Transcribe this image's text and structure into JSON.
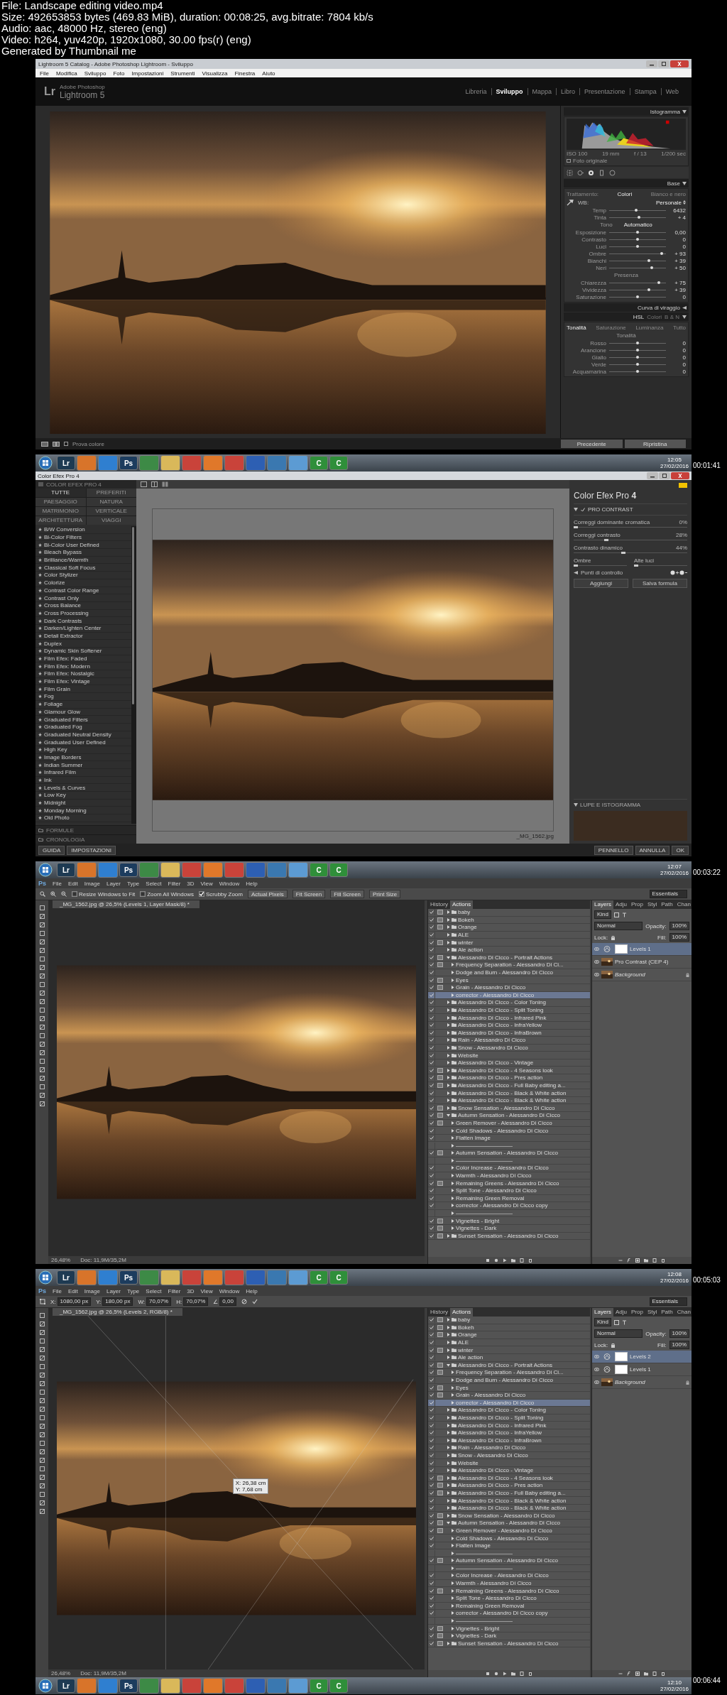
{
  "file_info": [
    "File: Landscape editing video.mp4",
    "Size: 492653853 bytes (469.83 MiB), duration: 00:08:25, avg.bitrate: 7804 kb/s",
    "Audio: aac, 48000 Hz, stereo (eng)",
    "Video: h264, yuv420p, 1920x1080, 30.00 fps(r) (eng)",
    "Generated by Thumbnail me"
  ],
  "frames": [
    {
      "kind": "lightroom",
      "window_title": "Lightroom 5 Catalog - Adobe Photoshop Lightroom - Sviluppo",
      "menu": [
        "File",
        "Modifica",
        "Sviluppo",
        "Foto",
        "Impostazioni",
        "Strumenti",
        "Visualizza",
        "Finestra",
        "Aiuto"
      ],
      "logo": {
        "badge": "Lr",
        "subtitle": "Adobe Photoshop",
        "name": "Lightroom 5"
      },
      "modules": [
        {
          "label": "Libreria",
          "selected": false
        },
        {
          "label": "Sviluppo",
          "selected": true
        },
        {
          "label": "Mappa",
          "selected": false
        },
        {
          "label": "Libro",
          "selected": false
        },
        {
          "label": "Presentazione",
          "selected": false
        },
        {
          "label": "Stampa",
          "selected": false
        },
        {
          "label": "Web",
          "selected": false
        }
      ],
      "histogram": {
        "title": "Istogramma",
        "readouts": [
          "ISO 100",
          "19 mm",
          "f / 13",
          "1/200 sec"
        ],
        "original_label": "Foto originale"
      },
      "base": {
        "title": "Base",
        "treatment_label": "Trattamento:",
        "treatments": [
          {
            "label": "Colori",
            "selected": true
          },
          {
            "label": "Bianco e nero",
            "selected": false
          }
        ],
        "wb_label": "WB:",
        "wb_value": "Personale",
        "groups": [
          {
            "sliders": [
              {
                "label": "Temp",
                "value": "6432",
                "level": 0.47
              },
              {
                "label": "Tinta",
                "value": "+ 4",
                "level": 0.53
              }
            ]
          },
          {
            "heading": "Tono",
            "action": "Automatico",
            "sliders": [
              {
                "label": "Esposizione",
                "value": "0,00",
                "level": 0.5
              },
              {
                "label": "Contrasto",
                "value": "0",
                "level": 0.5
              }
            ]
          },
          {
            "sliders": [
              {
                "label": "Luci",
                "value": "0",
                "level": 0.5
              },
              {
                "label": "Ombre",
                "value": "+ 93",
                "level": 0.93
              },
              {
                "label": "Bianchi",
                "value": "+ 39",
                "level": 0.7
              },
              {
                "label": "Neri",
                "value": "+ 50",
                "level": 0.75
              }
            ]
          },
          {
            "heading": "Presenza",
            "sliders": [
              {
                "label": "Chiarezza",
                "value": "+ 75",
                "level": 0.88
              },
              {
                "label": "Vividezza",
                "value": "+ 39",
                "level": 0.7
              },
              {
                "label": "Saturazione",
                "value": "0",
                "level": 0.5
              }
            ]
          }
        ]
      },
      "tone_curve_title": "Curva di viraggio",
      "hsl": {
        "modes": [
          {
            "label": "HSL",
            "selected": true
          },
          {
            "label": "Colori",
            "selected": false
          },
          {
            "label": "B & N",
            "selected": false
          }
        ],
        "tabs": [
          {
            "label": "Tonalità",
            "selected": true
          },
          {
            "label": "Saturazione",
            "selected": false
          },
          {
            "label": "Luminanza",
            "selected": false
          },
          {
            "label": "Tutto",
            "selected": false
          }
        ],
        "heading": "Tonalità",
        "sliders": [
          {
            "label": "Rosso",
            "value": "0",
            "level": 0.5
          },
          {
            "label": "Arancione",
            "value": "0",
            "level": 0.5
          },
          {
            "label": "Giallo",
            "value": "0",
            "level": 0.5
          },
          {
            "label": "Verde",
            "value": "0",
            "level": 0.5
          },
          {
            "label": "Acquamarina",
            "value": "0",
            "level": 0.5
          }
        ]
      },
      "toolbar_label": "Prova colore",
      "buttons": [
        "Precedente",
        "Ripristina"
      ]
    },
    {
      "kind": "color_efex",
      "timestamp": "00:01:41",
      "taskbar": {
        "apps": [
          {
            "label": "Lr",
            "color": "#1e3a52"
          },
          {
            "color": "#d8742a"
          },
          {
            "color": "#2f7fd0"
          },
          {
            "label": "Ps",
            "color": "#1c3c5e"
          },
          {
            "color": "#3d8a46"
          },
          {
            "color": "#d9b85a"
          },
          {
            "color": "#c9433a"
          },
          {
            "color": "#e0782a"
          },
          {
            "color": "#c9433a"
          },
          {
            "color": "#2d5fb3"
          },
          {
            "color": "#3a78b0"
          },
          {
            "color": "#5c9bd3"
          },
          {
            "label": "C",
            "color": "#2f8f3a"
          },
          {
            "label": "C",
            "color": "#2f8f3a"
          }
        ],
        "time": "12:05",
        "date": "27/02/2016"
      },
      "window_title": "Color Efex Pro 4",
      "library": {
        "title": "COLOR EFEX PRO 4",
        "categories": [
          {
            "label": "TUTTE",
            "selected": true
          },
          {
            "label": "PREFERITI",
            "selected": false
          },
          {
            "label": "PAESAGGIO",
            "selected": false
          },
          {
            "label": "NATURA",
            "selected": false
          },
          {
            "label": "MATRIMONIO",
            "selected": false
          },
          {
            "label": "VERTICALE",
            "selected": false
          },
          {
            "label": "ARCHITETTURA",
            "selected": false
          },
          {
            "label": "VIAGGI",
            "selected": false
          }
        ],
        "filters": [
          {
            "name": "B/W Conversion",
            "selected": false
          },
          {
            "name": "Bi-Color Filters",
            "selected": false
          },
          {
            "name": "Bi-Color User Defined",
            "selected": false
          },
          {
            "name": "Bleach Bypass",
            "selected": false
          },
          {
            "name": "Brilliance/Warmth",
            "selected": false
          },
          {
            "name": "Classical Soft Focus",
            "selected": false
          },
          {
            "name": "Color Stylizer",
            "selected": false
          },
          {
            "name": "Colorize",
            "selected": false
          },
          {
            "name": "Contrast Color Range",
            "selected": false
          },
          {
            "name": "Contrast Only",
            "selected": false
          },
          {
            "name": "Cross Balance",
            "selected": false
          },
          {
            "name": "Cross Processing",
            "selected": false
          },
          {
            "name": "Dark Contrasts",
            "selected": false
          },
          {
            "name": "Darken/Lighten Center",
            "selected": false
          },
          {
            "name": "Detail Extractor",
            "selected": false
          },
          {
            "name": "Duplex",
            "selected": false
          },
          {
            "name": "Dynamic Skin Softener",
            "selected": false
          },
          {
            "name": "Film Efex: Faded",
            "selected": false
          },
          {
            "name": "Film Efex: Modern",
            "selected": false
          },
          {
            "name": "Film Efex: Nostalgic",
            "selected": false
          },
          {
            "name": "Film Efex: Vintage",
            "selected": false
          },
          {
            "name": "Film Grain",
            "selected": false
          },
          {
            "name": "Fog",
            "selected": false
          },
          {
            "name": "Foliage",
            "selected": false
          },
          {
            "name": "Glamour Glow",
            "selected": false
          },
          {
            "name": "Graduated Filters",
            "selected": false
          },
          {
            "name": "Graduated Fog",
            "selected": false
          },
          {
            "name": "Graduated Neutral Density",
            "selected": false
          },
          {
            "name": "Graduated User Defined",
            "selected": false
          },
          {
            "name": "High Key",
            "selected": false
          },
          {
            "name": "Image Borders",
            "selected": false
          },
          {
            "name": "Indian Summer",
            "selected": false
          },
          {
            "name": "Infrared Film",
            "selected": false
          },
          {
            "name": "Ink",
            "selected": false
          },
          {
            "name": "Levels & Curves",
            "selected": false
          },
          {
            "name": "Low Key",
            "selected": false
          },
          {
            "name": "Midnight",
            "selected": false
          },
          {
            "name": "Monday Morning",
            "selected": false
          },
          {
            "name": "Old Photo",
            "selected": false
          }
        ],
        "sections": [
          "FORMULE",
          "CRONOLOGIA"
        ]
      },
      "filename": "_MG_1562.jpg",
      "controls": {
        "title": "Color Efex Pro **4**",
        "filter": {
          "name": "PRO CONTRAST",
          "enabled": true
        },
        "sliders": [
          {
            "label": "Correggi dominante cromatica",
            "value": "0%",
            "level": 0
          },
          {
            "label": "Correggi contrasto",
            "value": "28%",
            "level": 0.28
          },
          {
            "label": "Contrasto dinamico",
            "value": "44%",
            "level": 0.44
          }
        ],
        "tone_sliders": [
          {
            "label": "Ombre",
            "level": 0
          },
          {
            "label": "Alte luci",
            "level": 0
          }
        ],
        "control_points_label": "Punti di controllo",
        "buttons": [
          "Aggiungi",
          "Salva formula"
        ],
        "loupe_label": "LUPE E ISTOGRAMMA"
      },
      "footer_left": [
        "GUIDA",
        "IMPOSTAZIONI"
      ],
      "footer_right": [
        "PENNELLO",
        "ANNULLA",
        "OK"
      ]
    },
    {
      "kind": "photoshop",
      "timestamp": "00:03:22",
      "taskbar": {
        "apps": [
          {
            "label": "Lr",
            "color": "#1e3a52"
          },
          {
            "color": "#d8742a"
          },
          {
            "color": "#2f7fd0"
          },
          {
            "label": "Ps",
            "color": "#1c3c5e"
          },
          {
            "color": "#3d8a46"
          },
          {
            "color": "#d9b85a"
          },
          {
            "color": "#c9433a"
          },
          {
            "color": "#e0782a"
          },
          {
            "color": "#c9433a"
          },
          {
            "color": "#2d5fb3"
          },
          {
            "color": "#3a78b0"
          },
          {
            "color": "#5c9bd3"
          },
          {
            "label": "C",
            "color": "#2f8f3a"
          },
          {
            "label": "C",
            "color": "#2f8f3a"
          }
        ],
        "time": "12:07",
        "date": "27/02/2016"
      },
      "logo": "Ps",
      "menu": [
        "File",
        "Edit",
        "Image",
        "Layer",
        "Type",
        "Select",
        "Filter",
        "3D",
        "View",
        "Window",
        "Help"
      ],
      "options": [
        {
          "kind": "checkbox",
          "label": "Resize Windows to Fit",
          "checked": false
        },
        {
          "kind": "checkbox",
          "label": "Zoom All Windows",
          "checked": false
        },
        {
          "kind": "checkbox",
          "label": "Scrubby Zoom",
          "checked": true
        },
        {
          "kind": "button",
          "label": "Actual Pixels"
        },
        {
          "kind": "button",
          "label": "Fit Screen"
        },
        {
          "kind": "button",
          "label": "Fill Screen"
        },
        {
          "kind": "button",
          "label": "Print Size"
        }
      ],
      "workspace": "Essentials",
      "document_tab": "_MG_1562.jpg @ 26,5% (Levels 1, Layer Mask/8) *",
      "status": [
        "26,48%",
        "Doc: 11,9M/35,2M"
      ],
      "actions_panel": {
        "tabs": [
          {
            "label": "History",
            "selected": false
          },
          {
            "label": "Actions",
            "selected": true
          }
        ],
        "items": [
          {
            "kind": "set",
            "name": "baby",
            "checked": true,
            "dialog": true,
            "expanded": false,
            "selected": false
          },
          {
            "kind": "set",
            "name": "Bokeh",
            "checked": true,
            "dialog": true,
            "expanded": false,
            "selected": false
          },
          {
            "kind": "set",
            "name": "Orange",
            "checked": true,
            "dialog": true,
            "expanded": false,
            "selected": false
          },
          {
            "kind": "set",
            "name": "ALE",
            "checked": true,
            "dialog": false,
            "expanded": false,
            "selected": false
          },
          {
            "kind": "set",
            "name": "winter",
            "checked": true,
            "dialog": true,
            "expanded": false,
            "selected": false
          },
          {
            "kind": "set",
            "name": "Ale action",
            "checked": true,
            "dialog": false,
            "expanded": false,
            "selected": false
          },
          {
            "kind": "set",
            "name": "Alessandro Di Cicco - Portrait Actions",
            "checked": true,
            "dialog": true,
            "expanded": true,
            "selected": false,
            "children": [
              {
                "kind": "action",
                "name": "Frequency Separation - Alessandro Di Ci...",
                "checked": true,
                "dialog": true,
                "selected": false
              },
              {
                "kind": "action",
                "name": "Dodge and Burn - Alessandro Di Cicco",
                "checked": true,
                "dialog": false,
                "selected": false
              },
              {
                "kind": "action",
                "name": "Eyes",
                "checked": true,
                "dialog": true,
                "selected": false
              },
              {
                "kind": "action",
                "name": "Grain - Alessandro Di Cicco",
                "checked": true,
                "dialog": true,
                "selected": false
              },
              {
                "kind": "action",
                "name": "corrector - Alessandro Di Cicco",
                "checked": true,
                "dialog": false,
                "selected": true
              }
            ]
          },
          {
            "kind": "set",
            "name": "Alessandro Di Cicco - Color Toning",
            "checked": true,
            "dialog": false,
            "expanded": false,
            "selected": false
          },
          {
            "kind": "set",
            "name": "Alessandro Di Cicco - Split Toning",
            "checked": true,
            "dialog": false,
            "expanded": false,
            "selected": false
          },
          {
            "kind": "set",
            "name": "Alessandro Di Cicco - Infrared Pink",
            "checked": true,
            "dialog": false,
            "expanded": false,
            "selected": false
          },
          {
            "kind": "set",
            "name": "Alessandro Di Cicco - InfraYellow",
            "checked": true,
            "dialog": false,
            "expanded": false,
            "selected": false
          },
          {
            "kind": "set",
            "name": "Alessandro Di Cicco - InfraBrown",
            "checked": true,
            "dialog": false,
            "expanded": false,
            "selected": false
          },
          {
            "kind": "set",
            "name": "Rain - Alessandro Di Cicco",
            "checked": true,
            "dialog": false,
            "expanded": false,
            "selected": false
          },
          {
            "kind": "set",
            "name": "Snow - Alessandro Di Cicco",
            "checked": true,
            "dialog": false,
            "expanded": false,
            "selected": false
          },
          {
            "kind": "set",
            "name": "Website",
            "checked": true,
            "dialog": false,
            "expanded": false,
            "selected": false
          },
          {
            "kind": "set",
            "name": "Alessandro Di Cicco - Vintage",
            "checked": true,
            "dialog": false,
            "expanded": false,
            "selected": false
          },
          {
            "kind": "set",
            "name": "Alessandro Di Cicco - 4 Seasons look",
            "checked": true,
            "dialog": true,
            "expanded": false,
            "selected": false
          },
          {
            "kind": "set",
            "name": "Alessandro Di Cicco - Pres action",
            "checked": true,
            "dialog": true,
            "expanded": false,
            "selected": false
          },
          {
            "kind": "set",
            "name": "Alessandro Di Cicco - Full Baby editing a...",
            "checked": true,
            "dialog": true,
            "expanded": false,
            "selected": false
          },
          {
            "kind": "set",
            "name": "Alessandro Di Cicco - Black & White action",
            "checked": true,
            "dialog": false,
            "expanded": false,
            "selected": false
          },
          {
            "kind": "set",
            "name": "Alessandro Di Cicco - Black & White action",
            "checked": true,
            "dialog": false,
            "expanded": false,
            "selected": false
          },
          {
            "kind": "set",
            "name": "Snow Sensation - Alessandro Di Cicco",
            "checked": true,
            "dialog": true,
            "expanded": false,
            "selected": false
          },
          {
            "kind": "set",
            "name": "Autumn Sensation - Alessandro Di Cicco",
            "checked": true,
            "dialog": true,
            "expanded": true,
            "selected": false,
            "children": [
              {
                "kind": "action",
                "name": "Green Remover - Alessandro Di Cicco",
                "checked": true,
                "dialog": true,
                "selected": false
              },
              {
                "kind": "action",
                "name": "Cold Shadows - Alessandro Di Cicco",
                "checked": true,
                "dialog": false,
                "selected": false
              },
              {
                "kind": "action",
                "name": "Flatten Image",
                "checked": true,
                "dialog": false,
                "selected": false
              },
              {
                "kind": "action",
                "name": "——————————",
                "checked": false,
                "dialog": false,
                "selected": false
              },
              {
                "kind": "action",
                "name": "Autumn Sensation - Alessandro Di Cicco",
                "checked": true,
                "dialog": true,
                "selected": false
              },
              {
                "kind": "action",
                "name": "——————————",
                "checked": false,
                "dialog": false,
                "selected": false
              },
              {
                "kind": "action",
                "name": "Color Increase - Alessandro Di Cicco",
                "checked": true,
                "dialog": false,
                "selected": false
              },
              {
                "kind": "action",
                "name": "Warmth - Alessandro Di Cicco",
                "checked": true,
                "dialog": false,
                "selected": false
              },
              {
                "kind": "action",
                "name": "Remaining Greens - Alessandro Di Cicco",
                "checked": true,
                "dialog": true,
                "selected": false
              },
              {
                "kind": "action",
                "name": "Split Tone - Alessandro Di Cicco",
                "checked": true,
                "dialog": false,
                "selected": false
              },
              {
                "kind": "action",
                "name": "Remaining Green Removal",
                "checked": true,
                "dialog": false,
                "selected": false
              },
              {
                "kind": "action",
                "name": "corrector - Alessandro Di Cicco copy",
                "checked": true,
                "dialog": false,
                "selected": false
              },
              {
                "kind": "action",
                "name": "——————————",
                "checked": false,
                "dialog": false,
                "selected": false
              },
              {
                "kind": "action",
                "name": "Vignettes - Bright",
                "checked": true,
                "dialog": true,
                "selected": false
              },
              {
                "kind": "action",
                "name": "Vignettes - Dark",
                "checked": true,
                "dialog": true,
                "selected": false
              }
            ]
          },
          {
            "kind": "set",
            "name": "Sunset Sensation - Alessandro Di Cicco",
            "checked": true,
            "dialog": true,
            "expanded": false,
            "selected": false
          }
        ]
      },
      "layers_panel": {
        "tabs": [
          {
            "label": "Layers",
            "selected": true
          },
          {
            "label": "Adju",
            "selected": false
          },
          {
            "label": "Prop",
            "selected": false
          },
          {
            "label": "Styl",
            "selected": false
          },
          {
            "label": "Path",
            "selected": false
          },
          {
            "label": "Chan",
            "selected": false
          }
        ],
        "filter": "Kind",
        "blend_mode": "Normal",
        "opacity_label": "Opacity:",
        "opacity": "100%",
        "lock_label": "Lock:",
        "fill_label": "Fill:",
        "fill": "100%",
        "layers": [
          {
            "kind": "adjustment",
            "name": "Levels 1",
            "selected": true,
            "visible": true
          },
          {
            "kind": "pixel",
            "name": "Pro Contrast (CEP 4)",
            "selected": false,
            "visible": true
          },
          {
            "kind": "background",
            "name": "Background",
            "selected": false,
            "visible": true
          }
        ]
      }
    },
    {
      "kind": "photoshop",
      "timestamp": "00:05:03",
      "taskbar": {
        "apps": [
          {
            "label": "Lr",
            "color": "#1e3a52"
          },
          {
            "color": "#d8742a"
          },
          {
            "color": "#2f7fd0"
          },
          {
            "label": "Ps",
            "color": "#1c3c5e"
          },
          {
            "color": "#3d8a46"
          },
          {
            "color": "#d9b85a"
          },
          {
            "color": "#c9433a"
          },
          {
            "color": "#e0782a"
          },
          {
            "color": "#c9433a"
          },
          {
            "color": "#2d5fb3"
          },
          {
            "color": "#3a78b0"
          },
          {
            "color": "#5c9bd3"
          },
          {
            "label": "C",
            "color": "#2f8f3a"
          },
          {
            "label": "C",
            "color": "#2f8f3a"
          }
        ],
        "time": "12:08",
        "date": "27/02/2016"
      },
      "logo": "Ps",
      "menu": [
        "File",
        "Edit",
        "Image",
        "Layer",
        "Type",
        "Select",
        "Filter",
        "3D",
        "View",
        "Window",
        "Help"
      ],
      "options": [
        {
          "kind": "field",
          "label": "X:",
          "value": "1080,00 px"
        },
        {
          "kind": "field",
          "label": "Y:",
          "value": "180,00 px"
        },
        {
          "kind": "field",
          "label": "W:",
          "value": "70,07%"
        },
        {
          "kind": "field",
          "label": "H:",
          "value": "70,07%"
        },
        {
          "kind": "field",
          "label": "∠",
          "value": "0,00"
        }
      ],
      "workspace": "Essentials",
      "document_tab": "_MG_1562.jpg @ 26,5% (Levels 2, RGB/8) *",
      "status": [
        "26,48%",
        "Doc: 11,9M/35,2M"
      ],
      "transform": {
        "tooltip": [
          "X: 26,38 cm",
          "Y: 7,68 cm"
        ]
      },
      "actions_panel": {
        "tabs": [
          {
            "label": "History",
            "selected": false
          },
          {
            "label": "Actions",
            "selected": true
          }
        ],
        "items": [
          {
            "kind": "set",
            "name": "baby",
            "checked": true,
            "dialog": true,
            "expanded": false,
            "selected": false
          },
          {
            "kind": "set",
            "name": "Bokeh",
            "checked": true,
            "dialog": true,
            "expanded": false,
            "selected": false
          },
          {
            "kind": "set",
            "name": "Orange",
            "checked": true,
            "dialog": true,
            "expanded": false,
            "selected": false
          },
          {
            "kind": "set",
            "name": "ALE",
            "checked": true,
            "dialog": false,
            "expanded": false,
            "selected": false
          },
          {
            "kind": "set",
            "name": "winter",
            "checked": true,
            "dialog": true,
            "expanded": false,
            "selected": false
          },
          {
            "kind": "set",
            "name": "Ale action",
            "checked": true,
            "dialog": false,
            "expanded": false,
            "selected": false
          },
          {
            "kind": "set",
            "name": "Alessandro Di Cicco - Portrait Actions",
            "checked": true,
            "dialog": true,
            "expanded": true,
            "selected": false,
            "children": [
              {
                "kind": "action",
                "name": "Frequency Separation - Alessandro Di Ci...",
                "checked": true,
                "dialog": true,
                "selected": false
              },
              {
                "kind": "action",
                "name": "Dodge and Burn - Alessandro Di Cicco",
                "checked": true,
                "dialog": false,
                "selected": false
              },
              {
                "kind": "action",
                "name": "Eyes",
                "checked": true,
                "dialog": true,
                "selected": false
              },
              {
                "kind": "action",
                "name": "Grain - Alessandro Di Cicco",
                "checked": true,
                "dialog": true,
                "selected": false
              },
              {
                "kind": "action",
                "name": "corrector - Alessandro Di Cicco",
                "checked": true,
                "dialog": false,
                "selected": true
              }
            ]
          },
          {
            "kind": "set",
            "name": "Alessandro Di Cicco - Color Toning",
            "checked": true,
            "dialog": false,
            "expanded": false,
            "selected": false
          },
          {
            "kind": "set",
            "name": "Alessandro Di Cicco - Split Toning",
            "checked": true,
            "dialog": false,
            "expanded": false,
            "selected": false
          },
          {
            "kind": "set",
            "name": "Alessandro Di Cicco - Infrared Pink",
            "checked": true,
            "dialog": false,
            "expanded": false,
            "selected": false
          },
          {
            "kind": "set",
            "name": "Alessandro Di Cicco - InfraYellow",
            "checked": true,
            "dialog": false,
            "expanded": false,
            "selected": false
          },
          {
            "kind": "set",
            "name": "Alessandro Di Cicco - InfraBrown",
            "checked": true,
            "dialog": false,
            "expanded": false,
            "selected": false
          },
          {
            "kind": "set",
            "name": "Rain - Alessandro Di Cicco",
            "checked": true,
            "dialog": false,
            "expanded": false,
            "selected": false
          },
          {
            "kind": "set",
            "name": "Snow - Alessandro Di Cicco",
            "checked": true,
            "dialog": false,
            "expanded": false,
            "selected": false
          },
          {
            "kind": "set",
            "name": "Website",
            "checked": true,
            "dialog": false,
            "expanded": false,
            "selected": false
          },
          {
            "kind": "set",
            "name": "Alessandro Di Cicco - Vintage",
            "checked": true,
            "dialog": false,
            "expanded": false,
            "selected": false
          },
          {
            "kind": "set",
            "name": "Alessandro Di Cicco - 4 Seasons look",
            "checked": true,
            "dialog": true,
            "expanded": false,
            "selected": false
          },
          {
            "kind": "set",
            "name": "Alessandro Di Cicco - Pres action",
            "checked": true,
            "dialog": true,
            "expanded": false,
            "selected": false
          },
          {
            "kind": "set",
            "name": "Alessandro Di Cicco - Full Baby editing a...",
            "checked": true,
            "dialog": true,
            "expanded": false,
            "selected": false
          },
          {
            "kind": "set",
            "name": "Alessandro Di Cicco - Black & White action",
            "checked": true,
            "dialog": false,
            "expanded": false,
            "selected": false
          },
          {
            "kind": "set",
            "name": "Alessandro Di Cicco - Black & White action",
            "checked": true,
            "dialog": false,
            "expanded": false,
            "selected": false
          },
          {
            "kind": "set",
            "name": "Snow Sensation - Alessandro Di Cicco",
            "checked": true,
            "dialog": true,
            "expanded": false,
            "selected": false
          },
          {
            "kind": "set",
            "name": "Autumn Sensation - Alessandro Di Cicco",
            "checked": true,
            "dialog": true,
            "expanded": true,
            "selected": false,
            "children": [
              {
                "kind": "action",
                "name": "Green Remover - Alessandro Di Cicco",
                "checked": true,
                "dialog": true,
                "selected": false
              },
              {
                "kind": "action",
                "name": "Cold Shadows - Alessandro Di Cicco",
                "checked": true,
                "dialog": false,
                "selected": false
              },
              {
                "kind": "action",
                "name": "Flatten Image",
                "checked": true,
                "dialog": false,
                "selected": false
              },
              {
                "kind": "action",
                "name": "——————————",
                "checked": false,
                "dialog": false,
                "selected": false
              },
              {
                "kind": "action",
                "name": "Autumn Sensation - Alessandro Di Cicco",
                "checked": true,
                "dialog": true,
                "selected": false
              },
              {
                "kind": "action",
                "name": "——————————",
                "checked": false,
                "dialog": false,
                "selected": false
              },
              {
                "kind": "action",
                "name": "Color Increase - Alessandro Di Cicco",
                "checked": true,
                "dialog": false,
                "selected": false
              },
              {
                "kind": "action",
                "name": "Warmth - Alessandro Di Cicco",
                "checked": true,
                "dialog": false,
                "selected": false
              },
              {
                "kind": "action",
                "name": "Remaining Greens - Alessandro Di Cicco",
                "checked": true,
                "dialog": true,
                "selected": false
              },
              {
                "kind": "action",
                "name": "Split Tone - Alessandro Di Cicco",
                "checked": true,
                "dialog": false,
                "selected": false
              },
              {
                "kind": "action",
                "name": "Remaining Green Removal",
                "checked": true,
                "dialog": false,
                "selected": false
              },
              {
                "kind": "action",
                "name": "corrector - Alessandro Di Cicco copy",
                "checked": true,
                "dialog": false,
                "selected": false
              },
              {
                "kind": "action",
                "name": "——————————",
                "checked": false,
                "dialog": false,
                "selected": false
              },
              {
                "kind": "action",
                "name": "Vignettes - Bright",
                "checked": true,
                "dialog": true,
                "selected": false
              },
              {
                "kind": "action",
                "name": "Vignettes - Dark",
                "checked": true,
                "dialog": true,
                "selected": false
              }
            ]
          },
          {
            "kind": "set",
            "name": "Sunset Sensation - Alessandro Di Cicco",
            "checked": true,
            "dialog": true,
            "expanded": false,
            "selected": false
          }
        ]
      },
      "layers_panel": {
        "tabs": [
          {
            "label": "Layers",
            "selected": true
          },
          {
            "label": "Adju",
            "selected": false
          },
          {
            "label": "Prop",
            "selected": false
          },
          {
            "label": "Styl",
            "selected": false
          },
          {
            "label": "Path",
            "selected": false
          },
          {
            "label": "Chan",
            "selected": false
          }
        ],
        "filter": "Kind",
        "blend_mode": "Normal",
        "opacity_label": "Opacity:",
        "opacity": "100%",
        "lock_label": "Lock:",
        "fill_label": "Fill:",
        "fill": "100%",
        "layers": [
          {
            "kind": "adjustment",
            "name": "Levels 2",
            "selected": true,
            "visible": true
          },
          {
            "kind": "adjustment",
            "name": "Levels 1",
            "selected": false,
            "visible": true
          },
          {
            "kind": "background",
            "name": "Background",
            "selected": false,
            "visible": true
          }
        ]
      },
      "bottom_taskbar": {
        "apps": [
          {
            "label": "Lr",
            "color": "#1e3a52"
          },
          {
            "color": "#d8742a"
          },
          {
            "color": "#2f7fd0"
          },
          {
            "label": "Ps",
            "color": "#1c3c5e"
          },
          {
            "color": "#3d8a46"
          },
          {
            "color": "#d9b85a"
          },
          {
            "color": "#c9433a"
          },
          {
            "color": "#e0782a"
          },
          {
            "color": "#c9433a"
          },
          {
            "color": "#2d5fb3"
          },
          {
            "color": "#3a78b0"
          },
          {
            "color": "#5c9bd3"
          },
          {
            "label": "C",
            "color": "#2f8f3a"
          },
          {
            "label": "C",
            "color": "#2f8f3a"
          }
        ],
        "time": "12:10",
        "date": "27/02/2016"
      }
    }
  ],
  "end_timestamp": "00:06:44"
}
